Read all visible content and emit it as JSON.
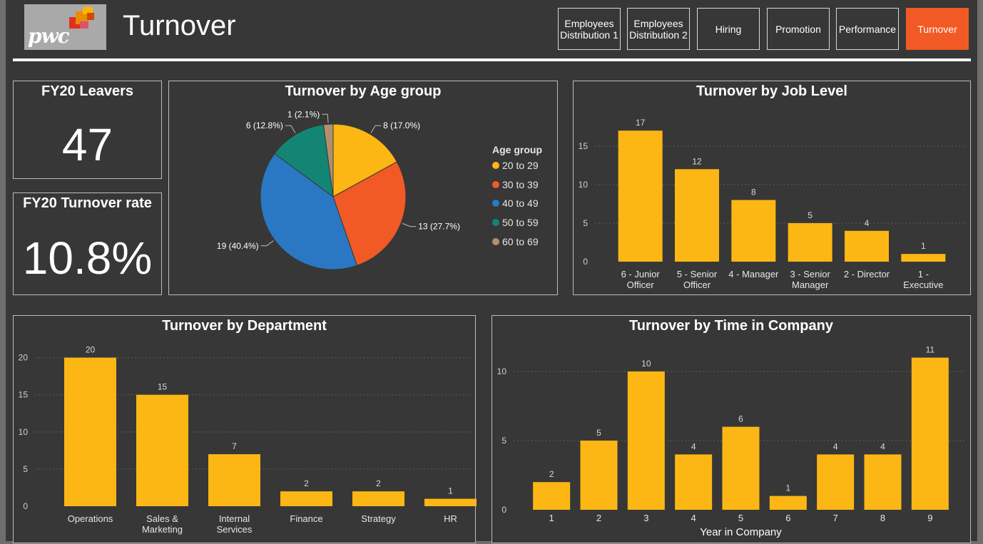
{
  "header": {
    "title": "Turnover",
    "logo_text": "pwc",
    "nav": [
      {
        "label": "Employees Distribution 1",
        "line1": "Employees",
        "line2": "Distribution 1",
        "active": false
      },
      {
        "label": "Employees Distribution 2",
        "line1": "Employees",
        "line2": "Distribution 2",
        "active": false
      },
      {
        "label": "Hiring",
        "line1": "Hiring",
        "line2": "",
        "active": false
      },
      {
        "label": "Promotion",
        "line1": "Promotion",
        "line2": "",
        "active": false
      },
      {
        "label": "Performance",
        "line1": "Performance",
        "line2": "",
        "active": false
      },
      {
        "label": "Turnover",
        "line1": "Turnover",
        "line2": "",
        "active": true
      }
    ]
  },
  "kpis": {
    "leavers": {
      "title": "FY20 Leavers",
      "value": "47"
    },
    "rate": {
      "title": "FY20 Turnover rate",
      "value": "10.8%"
    }
  },
  "colors": {
    "bar": "#fdb714",
    "accent": "#f15a24",
    "background": "#373737"
  },
  "chart_data": [
    {
      "id": "age",
      "type": "pie",
      "title": "Turnover by Age group",
      "legend_title": "Age group",
      "legend_position": "right",
      "slices": [
        {
          "label": "20 to 29",
          "value": 8,
          "display": "8 (17.0%)",
          "color": "#fdb714"
        },
        {
          "label": "30 to 39",
          "value": 13,
          "display": "13 (27.7%)",
          "color": "#f15a24"
        },
        {
          "label": "40 to 49",
          "value": 19,
          "display": "19 (40.4%)",
          "color": "#2a78c4"
        },
        {
          "label": "50 to 59",
          "value": 6,
          "display": "6 (12.8%)",
          "color": "#138575"
        },
        {
          "label": "60 to 69",
          "value": 1,
          "display": "1 (2.1%)",
          "color": "#b0906e"
        }
      ]
    },
    {
      "id": "joblevel",
      "type": "bar",
      "title": "Turnover by Job Level",
      "categories": [
        "6 - Junior Officer",
        "5 - Senior Officer",
        "4 - Manager",
        "3 - Senior Manager",
        "2 - Director",
        "1 - Executive"
      ],
      "category_lines": [
        [
          "6 - Junior",
          "Officer"
        ],
        [
          "5 - Senior",
          "Officer"
        ],
        [
          "4 - Manager"
        ],
        [
          "3 - Senior",
          "Manager"
        ],
        [
          "2 - Director"
        ],
        [
          "1 -",
          "Executive"
        ]
      ],
      "values": [
        17,
        12,
        8,
        5,
        4,
        1
      ],
      "yticks": [
        0,
        5,
        10,
        15
      ],
      "ylim": [
        0,
        18.5
      ],
      "xlabel": "",
      "grid": true
    },
    {
      "id": "department",
      "type": "bar",
      "title": "Turnover by Department",
      "categories": [
        "Operations",
        "Sales & Marketing",
        "Internal Services",
        "Finance",
        "Strategy",
        "HR"
      ],
      "category_lines": [
        [
          "Operations"
        ],
        [
          "Sales &",
          "Marketing"
        ],
        [
          "Internal",
          "Services"
        ],
        [
          "Finance"
        ],
        [
          "Strategy"
        ],
        [
          "HR"
        ]
      ],
      "values": [
        20,
        15,
        7,
        2,
        2,
        1
      ],
      "yticks": [
        0,
        5,
        10,
        15,
        20
      ],
      "ylim": [
        0,
        21.5
      ],
      "xlabel": "",
      "grid": true
    },
    {
      "id": "time",
      "type": "bar",
      "title": "Turnover by Time in Company",
      "categories": [
        "1",
        "2",
        "3",
        "4",
        "5",
        "6",
        "7",
        "8",
        "9"
      ],
      "category_lines": [
        [
          "1"
        ],
        [
          "2"
        ],
        [
          "3"
        ],
        [
          "4"
        ],
        [
          "5"
        ],
        [
          "6"
        ],
        [
          "7"
        ],
        [
          "8"
        ],
        [
          "9"
        ]
      ],
      "values": [
        2,
        5,
        10,
        4,
        6,
        1,
        4,
        4,
        11
      ],
      "yticks": [
        0,
        5,
        10
      ],
      "ylim": [
        0,
        11.7
      ],
      "xlabel": "Year in Company",
      "grid": true
    }
  ]
}
